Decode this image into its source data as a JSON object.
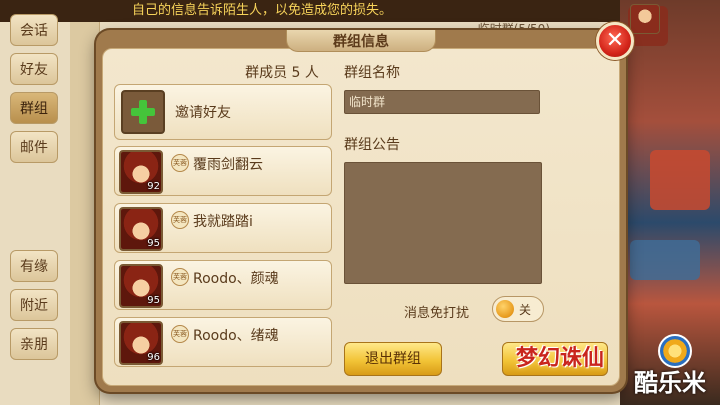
{
  "notice_text": "自己的信息告诉陌生人，以免造成您的损失。",
  "side_tabs": [
    "会话",
    "好友",
    "群组",
    "邮件"
  ],
  "side_tabs_bottom": [
    "有缘",
    "附近",
    "亲朋"
  ],
  "background_header": "临时群(5/50)",
  "dialog": {
    "title": "群组信息",
    "close_glyph": "✕",
    "members_title": "群成员 5 人",
    "invite_label": "邀请好友",
    "members": [
      {
        "name": "覆雨剑翻云",
        "level": "92",
        "sect": "芙蓉"
      },
      {
        "name": "我就踏踏i",
        "level": "95",
        "sect": "芙蓉"
      },
      {
        "name": "Roodo、颜魂",
        "level": "95",
        "sect": "芙蓉"
      },
      {
        "name": "Roodo、绪魂",
        "level": "96",
        "sect": "芙蓉"
      }
    ],
    "group_name_label": "群组名称",
    "group_name_value": "临时群",
    "group_notice_label": "群组公告",
    "dnd_label": "消息免打扰",
    "dnd_state": "关",
    "leave_button": "退出群组"
  },
  "game_logo": "梦幻诛仙",
  "watermark": "酷乐米",
  "colors": {
    "accent_green": "#45c43a",
    "close_red": "#d3251a",
    "button_gold": "#f2c437",
    "panel_parchment": "#f3e7cd"
  }
}
